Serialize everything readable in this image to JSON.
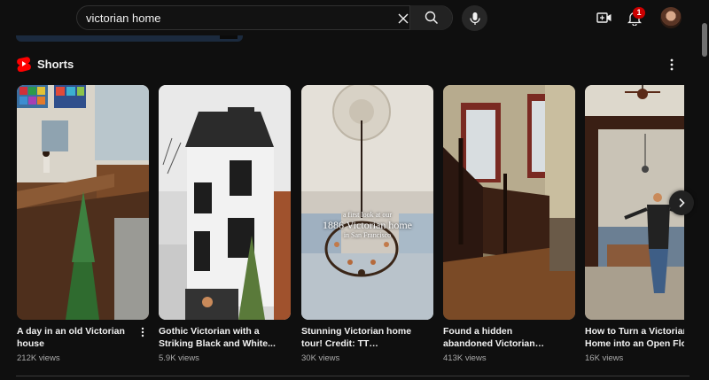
{
  "search": {
    "query": "victorian home",
    "placeholder": "Search"
  },
  "notifications": {
    "count": "1"
  },
  "shorts": {
    "title": "Shorts",
    "items": [
      {
        "title": "A day in an old Victorian house",
        "views": "212K views"
      },
      {
        "title": "Gothic Victorian with a Striking Black and White...",
        "views": "5.9K views"
      },
      {
        "title": "Stunning Victorian home tour! Credit: TT @evie_taber...",
        "views": "30K views",
        "overlay_line1": "a first look at our",
        "overlay_line2": "1886 Victorian home",
        "overlay_line3": "in San Francisco"
      },
      {
        "title": "Found a hidden abandoned Victorian Mansion",
        "views": "413K views"
      },
      {
        "title": "How to Turn a Victorian Home into an Open Floor...",
        "views": "16K views"
      }
    ]
  },
  "colors": {
    "accent_red": "#ff0000",
    "background": "#0f0f0f",
    "text_secondary": "#aaaaaa"
  },
  "icons": [
    "clear-icon",
    "search-icon",
    "mic-icon",
    "create-icon",
    "bell-icon",
    "shorts-logo-icon",
    "more-vert-icon",
    "chevron-right-icon"
  ]
}
